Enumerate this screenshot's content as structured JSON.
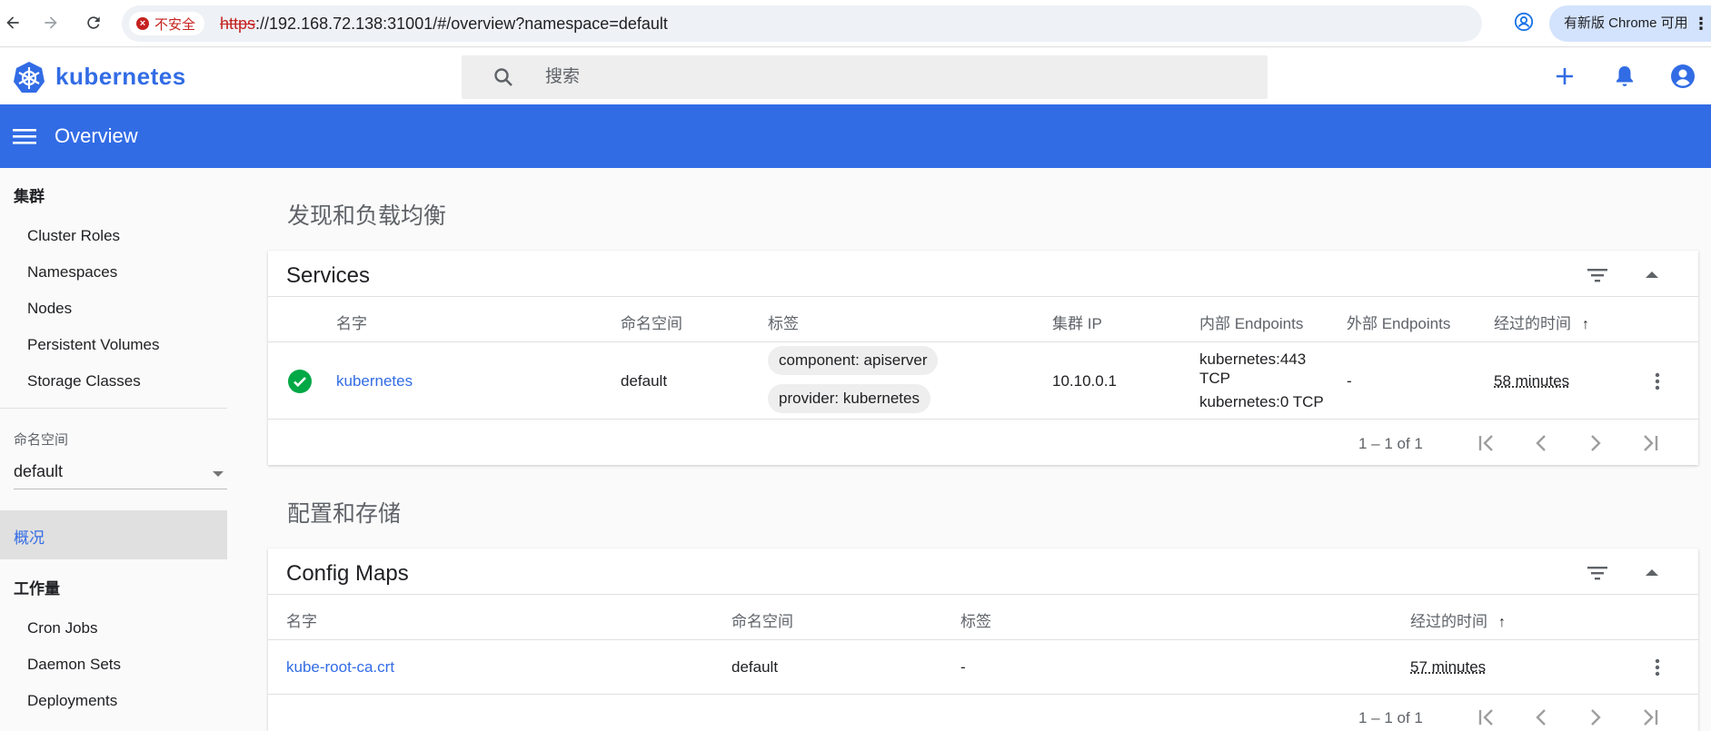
{
  "browser": {
    "security_label": "不安全",
    "url_scheme": "https",
    "url_rest": "://192.168.72.138:31001/#/overview?namespace=default",
    "update_label": "有新版 Chrome 可用",
    "icons": [
      "back-icon",
      "forward-icon",
      "reload-icon",
      "star-icon",
      "profile-icon",
      "more-icon"
    ]
  },
  "header": {
    "logo_text": "kubernetes",
    "search_placeholder": "搜索",
    "actions": [
      "add-icon",
      "bell-icon",
      "account-icon"
    ]
  },
  "toolbar": {
    "title": "Overview"
  },
  "sidebar": {
    "cluster_heading": "集群",
    "cluster_items": [
      {
        "label": "Cluster Roles"
      },
      {
        "label": "Namespaces"
      },
      {
        "label": "Nodes"
      },
      {
        "label": "Persistent Volumes"
      },
      {
        "label": "Storage Classes"
      }
    ],
    "namespace_label": "命名空间",
    "namespace_value": "default",
    "active_item": "概况",
    "workload_heading": "工作量",
    "workload_items": [
      {
        "label": "Cron Jobs"
      },
      {
        "label": "Daemon Sets"
      },
      {
        "label": "Deployments"
      }
    ]
  },
  "discovery": {
    "section_title": "发现和负载均衡",
    "card_title": "Services",
    "columns": {
      "name": "名字",
      "namespace": "命名空间",
      "labels": "标签",
      "cluster_ip": "集群 IP",
      "internal_endpoints": "内部 Endpoints",
      "external_endpoints": "外部 Endpoints",
      "age": "经过的时间"
    },
    "rows": [
      {
        "name": "kubernetes",
        "namespace": "default",
        "label_1": "component: apiserver",
        "label_2": "provider: kubernetes",
        "cluster_ip": "10.10.0.1",
        "internal_1": "kubernetes:443",
        "internal_1b": "TCP",
        "internal_2": "kubernetes:0 TCP",
        "external": "-",
        "age": "58 minutes"
      }
    ],
    "pager": "1 – 1 of 1"
  },
  "config": {
    "section_title": "配置和存储",
    "card_title": "Config Maps",
    "columns": {
      "name": "名字",
      "namespace": "命名空间",
      "labels": "标签",
      "age": "经过的时间"
    },
    "rows": [
      {
        "name": "kube-root-ca.crt",
        "namespace": "default",
        "labels": "-",
        "age": "57 minutes"
      }
    ],
    "pager": "1 – 1 of 1"
  },
  "colors": {
    "brand": "#326ce5",
    "status_ok": "#00a846",
    "insecure": "#c5221f"
  }
}
